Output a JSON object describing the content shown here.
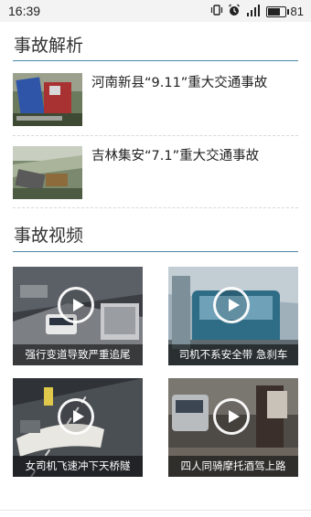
{
  "status_bar": {
    "time": "16:39",
    "battery": "81",
    "battery_level": 0.81,
    "icons": [
      "vibrate-icon",
      "alarm-icon",
      "signal-icon",
      "battery-icon"
    ]
  },
  "accident_analysis": {
    "title": "事故解析",
    "articles": [
      {
        "title": "河南新县“9.11”重大交通事故"
      },
      {
        "title": "吉林集安“7.1”重大交通事故"
      }
    ]
  },
  "accident_videos": {
    "title": "事故视频",
    "videos": [
      {
        "caption": "强行变道导致严重追尾"
      },
      {
        "caption": "司机不系安全带 急刹车"
      },
      {
        "caption": "女司机飞速冲下天桥隧"
      },
      {
        "caption": "四人同骑摩托酒驾上路"
      }
    ]
  },
  "colors": {
    "accent": "#4a86a6",
    "text": "#222222"
  }
}
